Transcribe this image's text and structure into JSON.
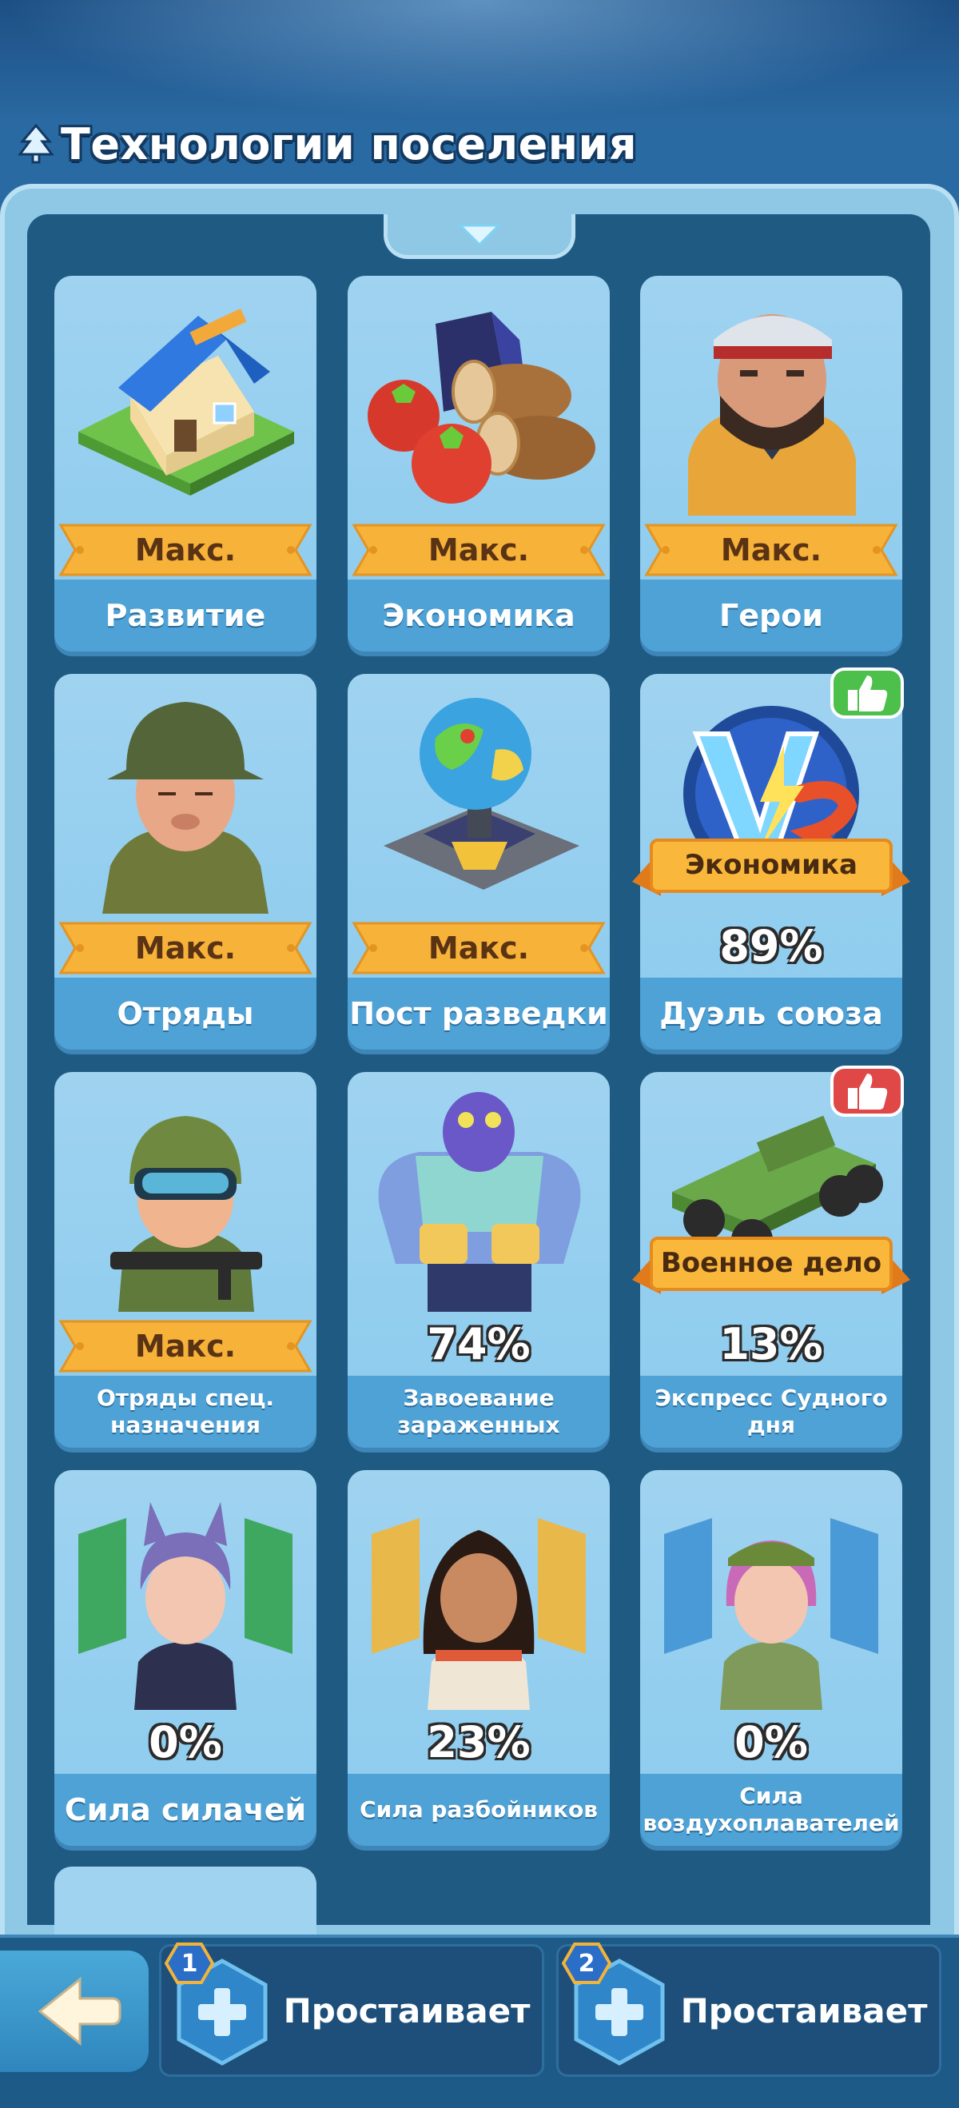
{
  "header": {
    "title": "Технологии поселения"
  },
  "cards": [
    {
      "label": "Развитие",
      "status": "Макс.",
      "icon": "house-icon"
    },
    {
      "label": "Экономика",
      "status": "Макс.",
      "icon": "resources-icon"
    },
    {
      "label": "Герои",
      "status": "Макс.",
      "icon": "hero-portrait-icon"
    },
    {
      "label": "Отряды",
      "status": "Макс.",
      "icon": "soldier-icon"
    },
    {
      "label": "Пост разведки",
      "status": "Макс.",
      "icon": "globe-outpost-icon"
    },
    {
      "label": "Дуэль союза",
      "progress": "89%",
      "banner": "Экономика",
      "icon": "versus-icon",
      "badge": "thumbs-up-green-icon"
    },
    {
      "label": "Отряды спец. назначения",
      "status": "Макс.",
      "icon": "special-forces-icon"
    },
    {
      "label": "Завоевание зараженных",
      "progress": "74%",
      "icon": "zombie-icon"
    },
    {
      "label": "Экспресс Судного дня",
      "progress": "13%",
      "banner": "Военное дело",
      "icon": "armored-truck-icon",
      "badge": "thumbs-up-red-icon"
    },
    {
      "label": "Сила силачей",
      "progress": "0%",
      "icon": "brawler-hero-icon"
    },
    {
      "label": "Сила разбойников",
      "progress": "23%",
      "icon": "bandit-hero-icon"
    },
    {
      "label": "Сила воздухоплавателей",
      "progress": "0%",
      "icon": "aeronaut-hero-icon"
    }
  ],
  "bottom": {
    "slots": [
      {
        "number": "1",
        "label": "Простаивает"
      },
      {
        "number": "2",
        "label": "Простаивает"
      }
    ]
  },
  "colors": {
    "background": "#2f76b0",
    "card": "#9fd3f0",
    "card_footer": "#4ea2d6",
    "ribbon": "#f7b23a",
    "accent_green": "#4cc04a",
    "accent_red": "#e04848"
  }
}
